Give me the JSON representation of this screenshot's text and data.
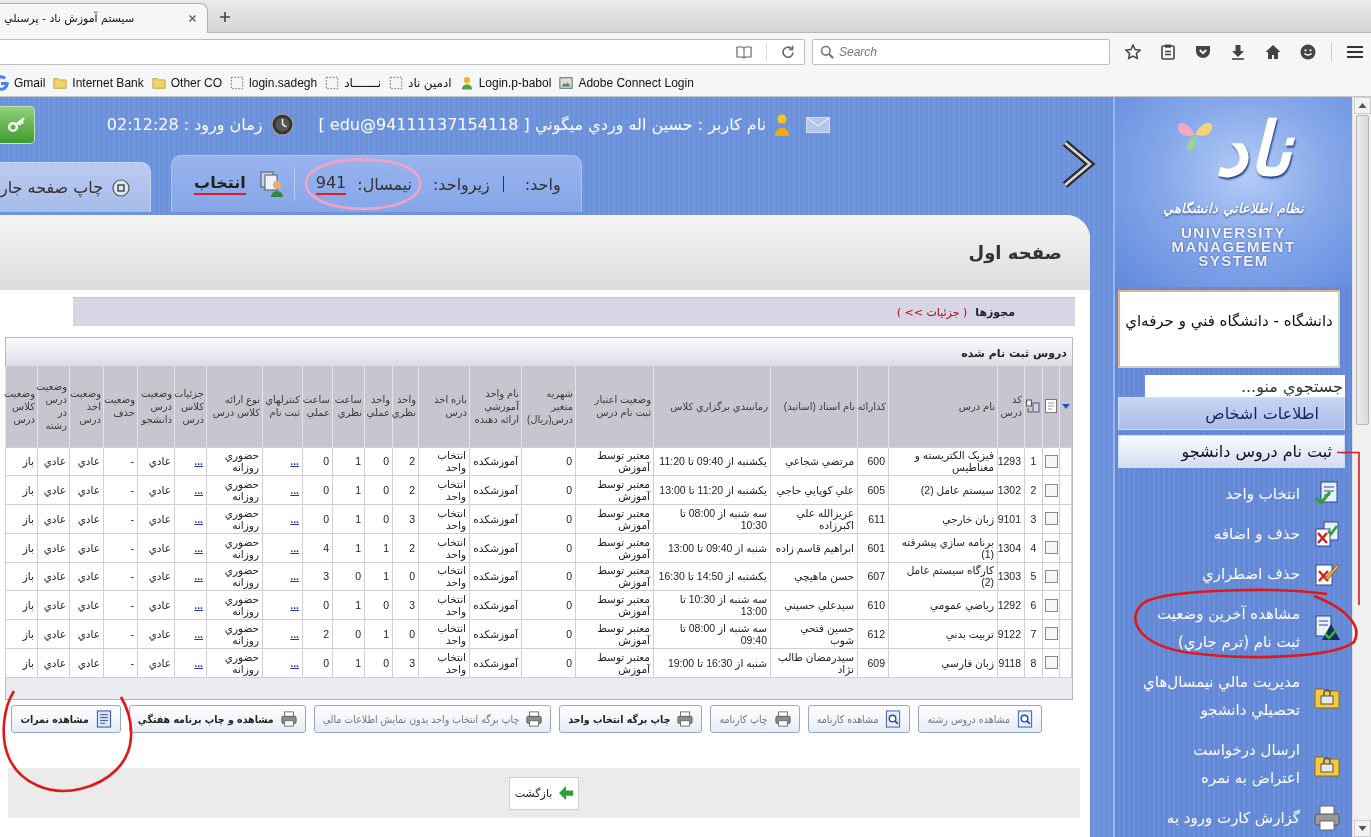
{
  "browser": {
    "tab": {
      "title": "سيستم آموزش ناد - پرسنلي",
      "selected": true
    },
    "search": {
      "placeholder": "Search"
    },
    "bookmarks": [
      {
        "label": "Adobe Connect Login",
        "kind": "app"
      },
      {
        "label": "Login.p-babol",
        "kind": "person"
      },
      {
        "label": "ادمين ناد",
        "kind": "page"
      },
      {
        "label": "نـــــــاد",
        "kind": "page"
      },
      {
        "label": "login.sadegh",
        "kind": "page"
      },
      {
        "label": "Other CO",
        "kind": "folder"
      },
      {
        "label": "Internet Bank",
        "kind": "folder"
      },
      {
        "label": "Gmail",
        "kind": "google"
      }
    ]
  },
  "header": {
    "user": "نام کاربر : حسين اله وردي ميگوني [ edu@94111137154118 ]",
    "login_time": "زمان ورود : 02:12:28"
  },
  "tabs": [
    {
      "kind": "context",
      "fields": [
        {
          "label": "واحد:",
          "circled": false
        },
        {
          "label": "زيرواحد:",
          "circled": false
        },
        {
          "label": "نيمسال:",
          "value": "941",
          "value_underlined": true,
          "circled": true
        }
      ],
      "action": {
        "label": "انتخاب",
        "underlined": true
      }
    },
    {
      "kind": "print",
      "label": "چاپ صفحه جار"
    }
  ],
  "page": {
    "title": "صفحه اول",
    "permissions": {
      "label": "مجوزها",
      "link": "( جزئيات >> )"
    },
    "table": {
      "title": "دروس ثبت نام شده",
      "select_all": {
        "checked": false
      },
      "columns": [
        {
          "label": "کد درس",
          "kind": "text"
        },
        {
          "label": "نام درس",
          "kind": "text"
        },
        {
          "label": "کدارائه",
          "kind": "text"
        },
        {
          "label": "نام استاد (اساتيد)",
          "kind": "text"
        },
        {
          "label": "زمانبندي برگزاري کلاس",
          "kind": "text"
        },
        {
          "label": "وضعيت اعتبار ثبت نام درس",
          "kind": "text"
        },
        {
          "label": "شهريه متغير درس(ريال)",
          "kind": "text"
        },
        {
          "label": "نام واحد آموزشي ارائه دهنده",
          "kind": "text"
        },
        {
          "label": "بازه اخذ درس",
          "kind": "text"
        },
        {
          "label": "واحد نظري",
          "kind": "text"
        },
        {
          "label": "واحد عملي",
          "kind": "text"
        },
        {
          "label": "ساعت نظري",
          "kind": "text"
        },
        {
          "label": "ساعت عملي",
          "kind": "text"
        },
        {
          "label": "کنترلهاي ثبت نام",
          "kind": "link"
        },
        {
          "label": "نوع ارائه کلاس درس",
          "kind": "text"
        },
        {
          "label": "جزئيات کلاس درس",
          "kind": "link"
        },
        {
          "label": "وضعيت درس دانشجو",
          "kind": "text"
        },
        {
          "label": "وضعيت حذف",
          "kind": "text"
        },
        {
          "label": "وضعيت اخذ درس",
          "kind": "text"
        },
        {
          "label": "وضعيت درس در رشته",
          "kind": "text"
        },
        {
          "label": "وضعيت کلاس درس",
          "kind": "text"
        }
      ],
      "rows": [
        {
          "checked": false,
          "number": "1",
          "cells": [
            "1293",
            "فيزيک الکتريسته و مغناطيس",
            "600",
            "مرتضي شجاعي",
            "يکشنبه از 09:40 تا 11:20",
            "معتبر توسط آموزش",
            "0",
            "آموزشکده",
            "انتخاب واحد",
            "2",
            "0",
            "1",
            "0",
            "...",
            "حضوري روزانه",
            "...",
            "عادي",
            "-",
            "عادي",
            "عادي",
            "باز"
          ]
        },
        {
          "checked": false,
          "number": "2",
          "cells": [
            "1302",
            "سيستم عامل (2)",
            "605",
            "علي کوپايي حاجي",
            "يکشنبه از 11:20 تا 13:00",
            "معتبر توسط آموزش",
            "0",
            "آموزشکده",
            "انتخاب واحد",
            "2",
            "0",
            "1",
            "0",
            "...",
            "حضوري روزانه",
            "...",
            "عادي",
            "-",
            "عادي",
            "عادي",
            "باز"
          ]
        },
        {
          "checked": false,
          "number": "3",
          "cells": [
            "9101",
            "زبان خارجي",
            "611",
            "عزيزالله علي اکبرزاده",
            "سه شنبه از 08:00 تا 10:30",
            "معتبر توسط آموزش",
            "0",
            "آموزشکده",
            "انتخاب واحد",
            "3",
            "0",
            "1",
            "0",
            "...",
            "حضوري روزانه",
            "...",
            "عادي",
            "-",
            "عادي",
            "عادي",
            "باز"
          ]
        },
        {
          "checked": false,
          "number": "4",
          "cells": [
            "1304",
            "برنامه سازي پيشرفته (1)",
            "601",
            "ابراهيم قاسم زاده",
            "شنبه از 09:40 تا 13:00",
            "معتبر توسط آموزش",
            "0",
            "آموزشکده",
            "انتخاب واحد",
            "2",
            "1",
            "1",
            "4",
            "...",
            "حضوري روزانه",
            "...",
            "عادي",
            "-",
            "عادي",
            "عادي",
            "باز"
          ]
        },
        {
          "checked": false,
          "number": "5",
          "cells": [
            "1303",
            "کارگاه سيستم عامل (2)",
            "607",
            "حسن ماهيچي",
            "يکشنبه از 14:50 تا 16:30",
            "معتبر توسط آموزش",
            "0",
            "آموزشکده",
            "انتخاب واحد",
            "0",
            "1",
            "0",
            "3",
            "...",
            "حضوري روزانه",
            "...",
            "عادي",
            "-",
            "عادي",
            "عادي",
            "باز"
          ]
        },
        {
          "checked": false,
          "number": "6",
          "cells": [
            "1292",
            "رياضي عمومي",
            "610",
            "سيدعلي حسيني",
            "سه شنبه از 10:30 تا 13:00",
            "معتبر توسط آموزش",
            "0",
            "آموزشکده",
            "انتخاب واحد",
            "3",
            "0",
            "1",
            "0",
            "...",
            "حضوري روزانه",
            "...",
            "عادي",
            "-",
            "عادي",
            "عادي",
            "باز"
          ]
        },
        {
          "checked": false,
          "number": "7",
          "cells": [
            "9122",
            "تربيت بدني",
            "612",
            "حسين فتحي شوب",
            "سه شنبه از 08:00 تا 09:40",
            "معتبر توسط آموزش",
            "0",
            "آموزشکده",
            "انتخاب واحد",
            "0",
            "1",
            "0",
            "2",
            "...",
            "حضوري روزانه",
            "...",
            "عادي",
            "-",
            "عادي",
            "عادي",
            "باز"
          ]
        },
        {
          "checked": false,
          "number": "8",
          "cells": [
            "9118",
            "زبان فارسي",
            "609",
            "سيدرمضان طالب نژاد",
            "شنبه از 16:30 تا 19:00",
            "معتبر توسط آموزش",
            "0",
            "آموزشکده",
            "انتخاب واحد",
            "3",
            "0",
            "1",
            "0",
            "...",
            "حضوري روزانه",
            "...",
            "عادي",
            "-",
            "عادي",
            "عادي",
            "باز"
          ]
        }
      ]
    },
    "buttons": [
      {
        "label": "مشاهده دروس رشته",
        "kind": "view",
        "disabled": true,
        "circled": false
      },
      {
        "label": "مشاهده کارنامه",
        "kind": "view",
        "disabled": true,
        "circled": false
      },
      {
        "label": "چاپ کارنامه",
        "kind": "print",
        "disabled": true,
        "circled": false
      },
      {
        "label": "چاپ برگه انتخاب واحد",
        "kind": "print",
        "disabled": false,
        "circled": false
      },
      {
        "label": "چاپ برگه انتخاب واحد بدون نمايش اطلاعات مالي",
        "kind": "print",
        "disabled": true,
        "circled": false
      },
      {
        "label": "مشاهده و چاپ برنامه هفتگي",
        "kind": "print",
        "disabled": false,
        "circled": false
      },
      {
        "label": "مشاهده نمرات",
        "kind": "report",
        "disabled": false,
        "circled": true
      }
    ],
    "back": {
      "label": "بازگشت"
    }
  },
  "sidebar": {
    "logo": {
      "mark": "ناد",
      "tagline": "نظام اطلاعاتي دانشگاهي",
      "lines": [
        "UNIVERSITY",
        "MANAGEMENT",
        "SYSTEM"
      ]
    },
    "university": "دانشگاه - دانشگاه فني و حرفه‌اي",
    "search": {
      "placeholder": "جستجوي منو..."
    },
    "sections": [
      {
        "label": "اطلاعات اشخاص",
        "expanded": false,
        "bracketed": false
      },
      {
        "label": "ثبت نام دروس دانشجو",
        "expanded": true,
        "bracketed": true,
        "items": [
          {
            "label": "انتخاب واحد",
            "kind": "select",
            "circled": false
          },
          {
            "label": "حذف و اضافه",
            "kind": "add-drop",
            "circled": false
          },
          {
            "label": "حذف اضطراري",
            "kind": "emergency",
            "circled": false
          },
          {
            "label": "مشاهده آخرين وضعيت ثبت نام (ترم جاري)",
            "kind": "status",
            "circled": true
          },
          {
            "label": "مديريت مالي نيمسال‌هاي تحصيلي دانشجو",
            "kind": "finance",
            "circled": false
          },
          {
            "label": "ارسال درخواست اعتراض به نمره",
            "kind": "finance",
            "circled": false
          },
          {
            "label": "گزارش کارت ورود به",
            "kind": "report",
            "circled": false
          }
        ]
      }
    ]
  }
}
